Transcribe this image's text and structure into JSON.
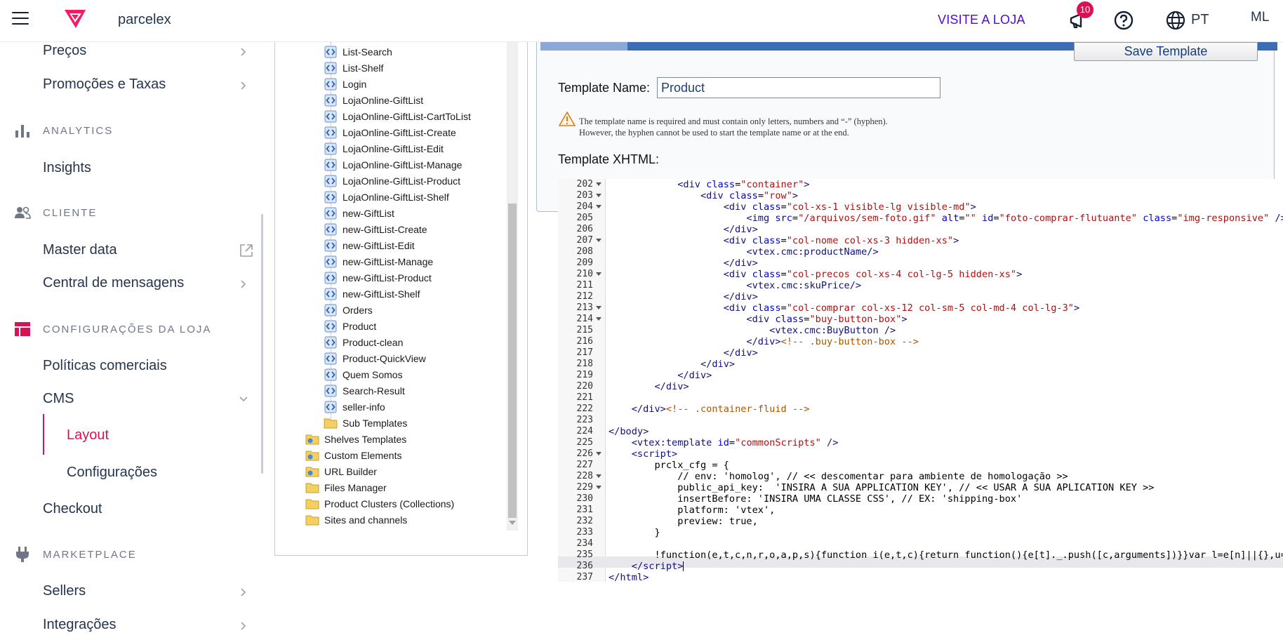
{
  "topbar": {
    "store_name": "parcelex",
    "visit_store": "VISITE A LOJA",
    "notification_count": "10",
    "language": "PT",
    "user_initials": "ML"
  },
  "sidebar": {
    "items_top": [
      {
        "label": "Preços"
      },
      {
        "label": "Promoções e Taxas"
      }
    ],
    "sections": {
      "analytics": "ANALYTICS",
      "cliente": "CLIENTE",
      "config": "CONFIGURAÇÕES DA LOJA",
      "marketplace": "MARKETPLACE"
    },
    "insights": "Insights",
    "master_data": "Master data",
    "central": "Central de mensagens",
    "politicas": "Políticas comerciais",
    "cms": "CMS",
    "layout": "Layout",
    "configuracoes": "Configurações",
    "checkout": "Checkout",
    "sellers": "Sellers",
    "integracoes": "Integrações",
    "accent_color": "#dc1152"
  },
  "tree": {
    "templates": [
      "List-Search",
      "List-Shelf",
      "Login",
      "LojaOnline-GiftList",
      "LojaOnline-GiftList-CartToList",
      "LojaOnline-GiftList-Create",
      "LojaOnline-GiftList-Edit",
      "LojaOnline-GiftList-Manage",
      "LojaOnline-GiftList-Product",
      "LojaOnline-GiftList-Shelf",
      "new-GiftList",
      "new-GiftList-Create",
      "new-GiftList-Edit",
      "new-GiftList-Manage",
      "new-GiftList-Product",
      "new-GiftList-Shelf",
      "Orders",
      "Product",
      "Product-clean",
      "Product-QuickView",
      "Quem Somos",
      "Search-Result",
      "seller-info"
    ],
    "sub_templates": "Sub Templates",
    "root_folders": [
      "Shelves Templates",
      "Custom Elements",
      "URL Builder",
      "Files Manager",
      "Product Clusters (Collections)",
      "Sites and channels"
    ]
  },
  "editor": {
    "save_label": "Save Template",
    "template_name_label": "Template Name:",
    "template_name_value": "Product",
    "warning_line1": "The template name is required and must contain only letters, numbers and “-” (hyphen).",
    "warning_line2": "However, the hyphen cannot be used to start the template name or at the end.",
    "xhtml_label": "Template XHTML:",
    "lines": [
      {
        "n": "202",
        "fold": true,
        "html": "            <span class='tag'>&lt;div</span> <span class='at'>class</span>=<span class='s'>\"container\"</span><span class='tag'>&gt;</span>"
      },
      {
        "n": "203",
        "fold": true,
        "html": "                <span class='tag'>&lt;div</span> <span class='at'>class</span>=<span class='s'>\"row\"</span><span class='tag'>&gt;</span>"
      },
      {
        "n": "204",
        "fold": true,
        "html": "                    <span class='tag'>&lt;div</span> <span class='at'>class</span>=<span class='s'>\"col-xs-1 visible-lg visible-md\"</span><span class='tag'>&gt;</span>"
      },
      {
        "n": "205",
        "fold": false,
        "html": "                        <span class='tag'>&lt;img</span> <span class='at'>src</span>=<span class='s'>\"/arquivos/sem-foto.gif\"</span> <span class='at'>alt</span>=<span class='s'>\"\"</span> <span class='at'>id</span>=<span class='s'>\"foto-comprar-flutuante\"</span> <span class='at'>class</span>=<span class='s'>\"img-responsive\"</span> <span class='tag'>/&gt;</span>"
      },
      {
        "n": "206",
        "fold": false,
        "html": "                    <span class='tag'>&lt;/div&gt;</span>"
      },
      {
        "n": "207",
        "fold": true,
        "html": "                    <span class='tag'>&lt;div</span> <span class='at'>class</span>=<span class='s'>\"col-nome col-xs-3 hidden-xs\"</span><span class='tag'>&gt;</span>"
      },
      {
        "n": "208",
        "fold": false,
        "html": "                        <span class='tag'>&lt;vtex.cmc:productName/&gt;</span>"
      },
      {
        "n": "209",
        "fold": false,
        "html": "                    <span class='tag'>&lt;/div&gt;</span>"
      },
      {
        "n": "210",
        "fold": true,
        "html": "                    <span class='tag'>&lt;div</span> <span class='at'>class</span>=<span class='s'>\"col-precos col-xs-4 col-lg-5 hidden-xs\"</span><span class='tag'>&gt;</span>"
      },
      {
        "n": "211",
        "fold": false,
        "html": "                        <span class='tag'>&lt;vtex.cmc:skuPrice/&gt;</span>"
      },
      {
        "n": "212",
        "fold": false,
        "html": "                    <span class='tag'>&lt;/div&gt;</span>"
      },
      {
        "n": "213",
        "fold": true,
        "html": "                    <span class='tag'>&lt;div</span> <span class='at'>class</span>=<span class='s'>\"col-comprar col-xs-12 col-sm-5 col-md-4 col-lg-3\"</span><span class='tag'>&gt;</span>"
      },
      {
        "n": "214",
        "fold": true,
        "html": "                        <span class='tag'>&lt;div</span> <span class='at'>class</span>=<span class='s'>\"buy-button-box\"</span><span class='tag'>&gt;</span>"
      },
      {
        "n": "215",
        "fold": false,
        "html": "                            <span class='tag'>&lt;vtex.cmc:BuyButton /&gt;</span>"
      },
      {
        "n": "216",
        "fold": false,
        "html": "                        <span class='tag'>&lt;/div&gt;</span><span class='cm'>&lt;!-- .buy-button-box --&gt;</span>"
      },
      {
        "n": "217",
        "fold": false,
        "html": "                    <span class='tag'>&lt;/div&gt;</span>"
      },
      {
        "n": "218",
        "fold": false,
        "html": "                <span class='tag'>&lt;/div&gt;</span>"
      },
      {
        "n": "219",
        "fold": false,
        "html": "            <span class='tag'>&lt;/div&gt;</span>"
      },
      {
        "n": "220",
        "fold": false,
        "html": "        <span class='tag'>&lt;/div&gt;</span>"
      },
      {
        "n": "221",
        "fold": false,
        "html": ""
      },
      {
        "n": "222",
        "fold": false,
        "html": "    <span class='tag'>&lt;/div&gt;</span><span class='cm'>&lt;!-- .container-fluid --&gt;</span>"
      },
      {
        "n": "223",
        "fold": false,
        "html": ""
      },
      {
        "n": "224",
        "fold": false,
        "html": "<span class='tag'>&lt;/body&gt;</span>"
      },
      {
        "n": "225",
        "fold": false,
        "html": "    <span class='tag'>&lt;vtex:template</span> <span class='at'>id</span>=<span class='s'>\"commonScripts\"</span> <span class='tag'>/&gt;</span>"
      },
      {
        "n": "226",
        "fold": true,
        "html": "    <span class='tag'>&lt;script&gt;</span>"
      },
      {
        "n": "227",
        "fold": false,
        "html": "        prclx_cfg = {"
      },
      {
        "n": "228",
        "fold": true,
        "html": "            // env: 'homolog', // &lt;&lt; descomentar para ambiente de homologação &gt;&gt;"
      },
      {
        "n": "229",
        "fold": true,
        "html": "            public_api_key:  'INSIRA A SUA APPLICATION KEY', // &lt;&lt; USAR A SUA APLICATION KEY &gt;&gt;"
      },
      {
        "n": "230",
        "fold": false,
        "html": "            insertBefore: 'INSIRA UMA CLASSE CSS', // EX: 'shipping-box'"
      },
      {
        "n": "231",
        "fold": false,
        "html": "            platform: 'vtex',"
      },
      {
        "n": "232",
        "fold": false,
        "html": "            preview: true,"
      },
      {
        "n": "233",
        "fold": false,
        "html": "        }"
      },
      {
        "n": "234",
        "fold": false,
        "html": ""
      },
      {
        "n": "235",
        "fold": false,
        "html": "        !function(e,t,c,n,r,o,a,p,s){function i(e,t,c){return function(){e[t]._.push([c,arguments])}}var l=e[n]||{},u=t.cre"
      },
      {
        "n": "236",
        "fold": false,
        "html": "    <span class='tag'>&lt;/script&gt;</span><span class='cursor'></span>"
      },
      {
        "n": "237",
        "fold": false,
        "html": "<span class='tag'>&lt;/html&gt;</span>"
      }
    ]
  }
}
